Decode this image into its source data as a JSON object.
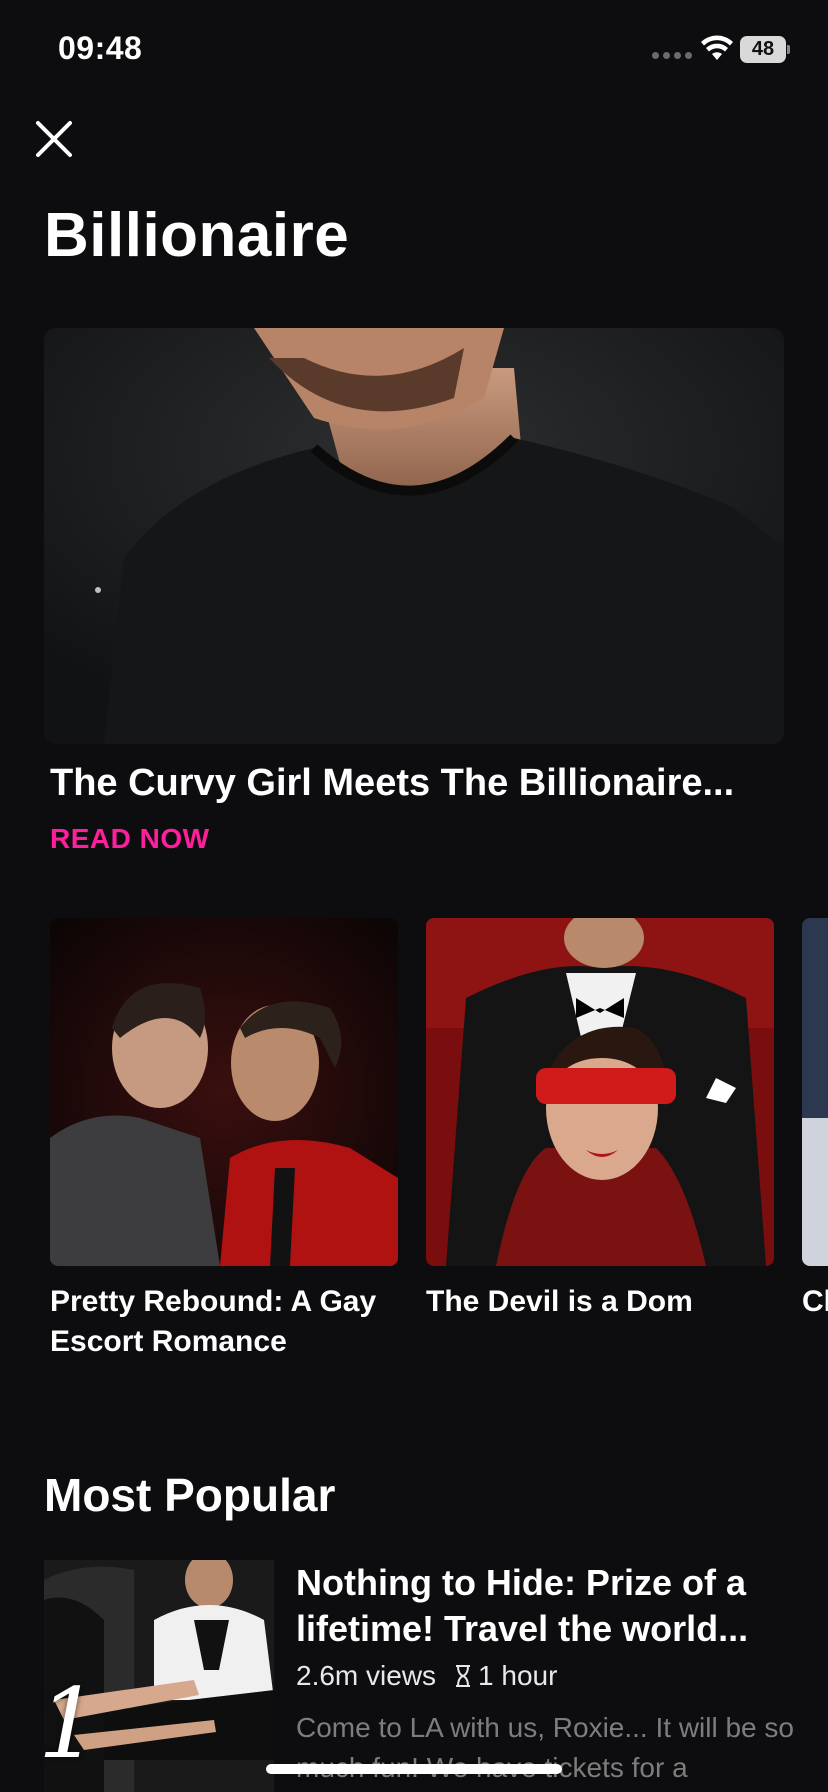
{
  "status": {
    "time": "09:48",
    "battery": "48"
  },
  "page": {
    "title": "Billionaire"
  },
  "hero": {
    "title": "The Curvy Girl Meets The Billionaire...",
    "cta": "READ NOW"
  },
  "carousel": {
    "items": [
      {
        "title": "Pretty Rebound: A Gay Escort Romance"
      },
      {
        "title": "The Devil is a Dom"
      },
      {
        "title": "Cl"
      }
    ]
  },
  "most_popular": {
    "title": "Most Popular",
    "items": [
      {
        "rank": "1",
        "title": "Nothing to Hide: Prize of a lifetime! Travel the world...",
        "views": "2.6m views",
        "duration": "1 hour",
        "description": "Come to LA with us, Roxie... It will be so much fun! We have tickets for a"
      }
    ]
  },
  "colors": {
    "accent": "#ff1f9d",
    "background": "#0d0d0f"
  },
  "icons": {
    "close": "close-icon",
    "wifi": "wifi-icon",
    "hourglass": "hourglass-icon"
  }
}
